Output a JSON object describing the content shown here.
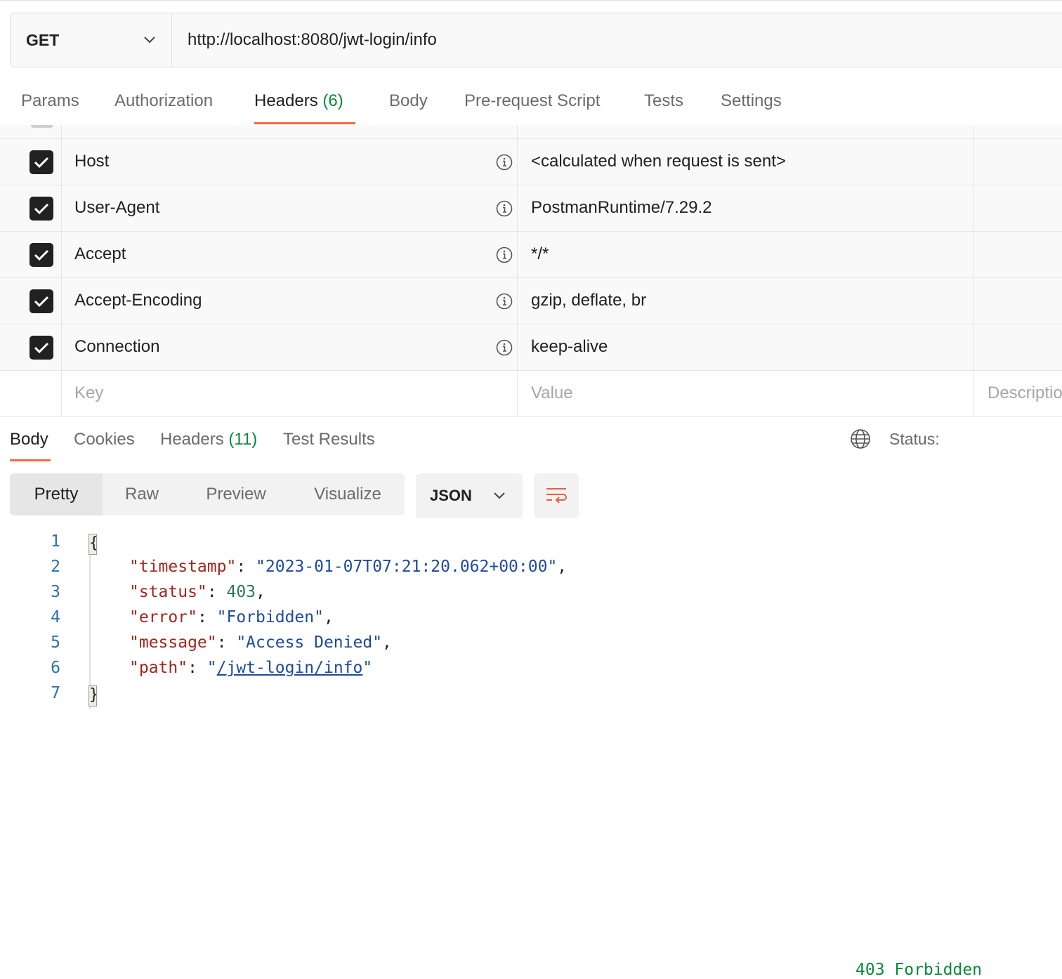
{
  "request": {
    "method": "GET",
    "url": "http://localhost:8080/jwt-login/info",
    "tabs": [
      {
        "label": "Params"
      },
      {
        "label": "Authorization"
      },
      {
        "label": "Headers",
        "count": "(6)"
      },
      {
        "label": "Body"
      },
      {
        "label": "Pre-request Script"
      },
      {
        "label": "Tests"
      },
      {
        "label": "Settings"
      }
    ],
    "active_tab": "Headers"
  },
  "headers_table": {
    "rows": [
      {
        "key": "Host",
        "value": "<calculated when request is sent>",
        "checked": true
      },
      {
        "key": "User-Agent",
        "value": "PostmanRuntime/7.29.2",
        "checked": true
      },
      {
        "key": "Accept",
        "value": "*/*",
        "checked": true
      },
      {
        "key": "Accept-Encoding",
        "value": "gzip, deflate, br",
        "checked": true
      },
      {
        "key": "Connection",
        "value": "keep-alive",
        "checked": true
      }
    ],
    "placeholders": {
      "key": "Key",
      "value": "Value",
      "description": "Descriptio"
    }
  },
  "response": {
    "tabs": [
      {
        "label": "Body"
      },
      {
        "label": "Cookies"
      },
      {
        "label": "Headers",
        "count": "(11)"
      },
      {
        "label": "Test Results"
      }
    ],
    "active_tab": "Body",
    "status_label": "Status:",
    "status_value": "403 Forbidden",
    "view_modes": [
      "Pretty",
      "Raw",
      "Preview",
      "Visualize"
    ],
    "active_view": "Pretty",
    "format": "JSON",
    "line_numbers": [
      "1",
      "2",
      "3",
      "4",
      "5",
      "6",
      "7"
    ],
    "json": {
      "open": "{",
      "close": "}",
      "timestamp_key": "\"timestamp\"",
      "timestamp_val": "\"2023-01-07T07:21:20.062+00:00\"",
      "status_key": "\"status\"",
      "status_val": "403",
      "error_key": "\"error\"",
      "error_val": "\"Forbidden\"",
      "message_key": "\"message\"",
      "message_val": "\"Access Denied\"",
      "path_key": "\"path\"",
      "path_val": "/jwt-login/info"
    }
  },
  "colors": {
    "accent": "#f26b3a",
    "success": "#0a8a3a",
    "json_key": "#a1271d",
    "json_string": "#1e4a9c"
  }
}
